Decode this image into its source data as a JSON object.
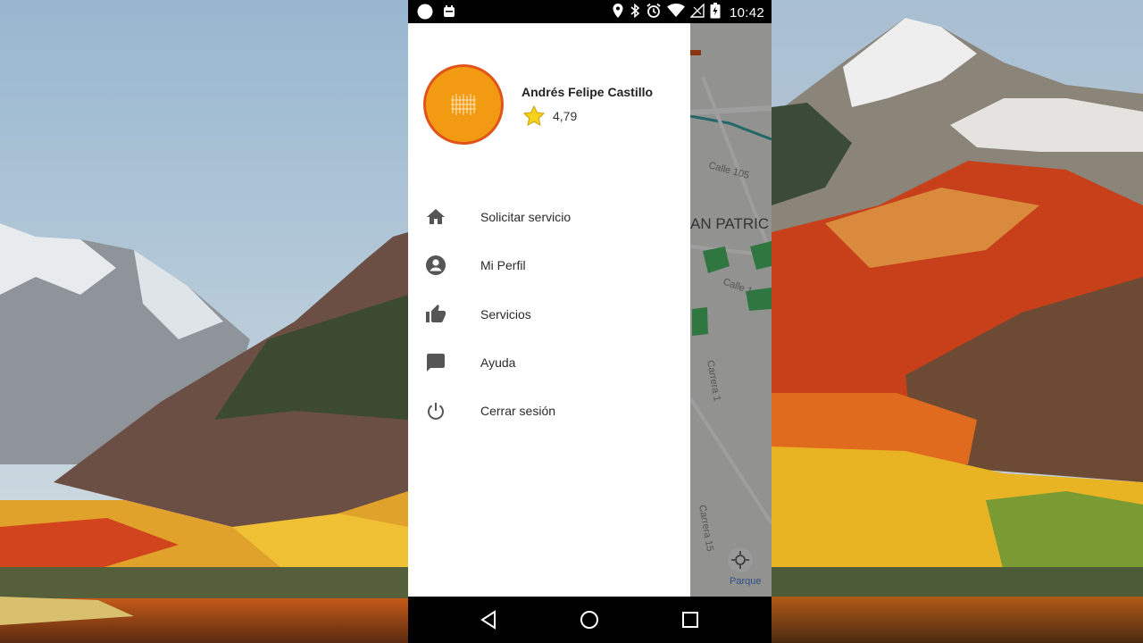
{
  "status_bar": {
    "time": "10:42",
    "icons": [
      "circle-notification-icon",
      "calendar-notification-icon",
      "location-icon",
      "bluetooth-icon",
      "alarm-icon",
      "wifi-icon",
      "no-signal-icon",
      "battery-charging-icon"
    ]
  },
  "map": {
    "street_labels": [
      "Calle 105",
      "AN PATRIC",
      "Calle 1",
      "Carrera 1",
      "Carrera 15",
      "Parque"
    ],
    "route_color": "#3aa6a6"
  },
  "drawer": {
    "user_name": "Andrés Felipe Castillo",
    "rating": "4,79",
    "avatar_color": "#f39a13",
    "avatar_border": "#e0541b",
    "menu": [
      {
        "label": "Solicitar servicio",
        "icon": "home-icon"
      },
      {
        "label": "Mi Perfil",
        "icon": "account-icon"
      },
      {
        "label": "Servicios",
        "icon": "thumb-up-icon"
      },
      {
        "label": "Ayuda",
        "icon": "chat-icon"
      },
      {
        "label": "Cerrar sesión",
        "icon": "power-icon"
      }
    ]
  },
  "nav_bar": {
    "buttons": [
      "back-icon",
      "home-circle-icon",
      "recents-icon"
    ]
  }
}
